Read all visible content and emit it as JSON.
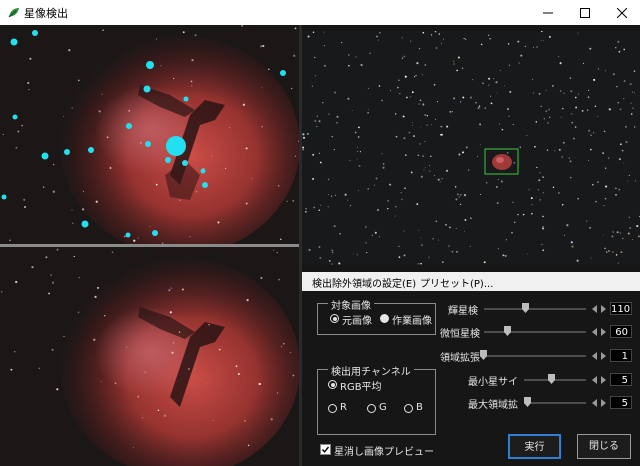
{
  "window": {
    "title": "星像検出"
  },
  "menu": {
    "items": [
      "検出除外領域の設定(E)",
      "プリセット(P)..."
    ]
  },
  "target_group": {
    "title": "対象画像",
    "options": [
      "元画像",
      "作業画像"
    ],
    "selected": "元画像"
  },
  "channel_group": {
    "title": "検出用チャンネル",
    "options": [
      "RGB平均",
      "R",
      "G",
      "B"
    ],
    "selected": "RGB平均"
  },
  "sliders": [
    {
      "label": "輝星検",
      "value": "110"
    },
    {
      "label": "微恒星検",
      "value": "60"
    },
    {
      "label": "領域拡張",
      "value": "1"
    },
    {
      "label": "最小星サイ",
      "value": "5"
    },
    {
      "label": "最大領域拡",
      "value": "5"
    }
  ],
  "preview": {
    "label": "星消し画像プレビュー",
    "checked": true
  },
  "buttons": {
    "execute": "実行",
    "close": "閉じる"
  },
  "colors": {
    "detection_marker": "#22e0f0",
    "selection_box": "#3ec93e",
    "nebula": "#c23a35",
    "default_button_border": "#2f7fd0"
  },
  "icons": [
    "app-leaf-icon",
    "minimize-icon",
    "maximize-icon",
    "close-icon",
    "slider-arrows-icon",
    "check-icon"
  ]
}
